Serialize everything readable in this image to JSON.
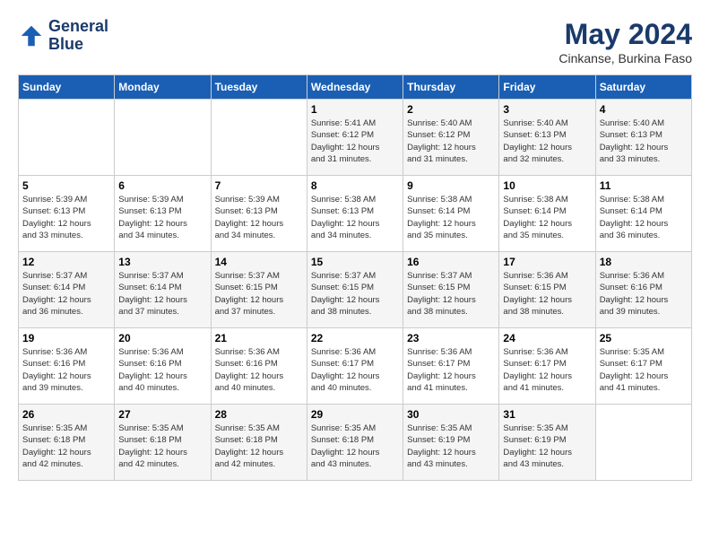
{
  "header": {
    "logo_line1": "General",
    "logo_line2": "Blue",
    "month_title": "May 2024",
    "location": "Cinkanse, Burkina Faso"
  },
  "weekdays": [
    "Sunday",
    "Monday",
    "Tuesday",
    "Wednesday",
    "Thursday",
    "Friday",
    "Saturday"
  ],
  "weeks": [
    [
      {
        "day": "",
        "info": ""
      },
      {
        "day": "",
        "info": ""
      },
      {
        "day": "",
        "info": ""
      },
      {
        "day": "1",
        "info": "Sunrise: 5:41 AM\nSunset: 6:12 PM\nDaylight: 12 hours\nand 31 minutes."
      },
      {
        "day": "2",
        "info": "Sunrise: 5:40 AM\nSunset: 6:12 PM\nDaylight: 12 hours\nand 31 minutes."
      },
      {
        "day": "3",
        "info": "Sunrise: 5:40 AM\nSunset: 6:13 PM\nDaylight: 12 hours\nand 32 minutes."
      },
      {
        "day": "4",
        "info": "Sunrise: 5:40 AM\nSunset: 6:13 PM\nDaylight: 12 hours\nand 33 minutes."
      }
    ],
    [
      {
        "day": "5",
        "info": "Sunrise: 5:39 AM\nSunset: 6:13 PM\nDaylight: 12 hours\nand 33 minutes."
      },
      {
        "day": "6",
        "info": "Sunrise: 5:39 AM\nSunset: 6:13 PM\nDaylight: 12 hours\nand 34 minutes."
      },
      {
        "day": "7",
        "info": "Sunrise: 5:39 AM\nSunset: 6:13 PM\nDaylight: 12 hours\nand 34 minutes."
      },
      {
        "day": "8",
        "info": "Sunrise: 5:38 AM\nSunset: 6:13 PM\nDaylight: 12 hours\nand 34 minutes."
      },
      {
        "day": "9",
        "info": "Sunrise: 5:38 AM\nSunset: 6:14 PM\nDaylight: 12 hours\nand 35 minutes."
      },
      {
        "day": "10",
        "info": "Sunrise: 5:38 AM\nSunset: 6:14 PM\nDaylight: 12 hours\nand 35 minutes."
      },
      {
        "day": "11",
        "info": "Sunrise: 5:38 AM\nSunset: 6:14 PM\nDaylight: 12 hours\nand 36 minutes."
      }
    ],
    [
      {
        "day": "12",
        "info": "Sunrise: 5:37 AM\nSunset: 6:14 PM\nDaylight: 12 hours\nand 36 minutes."
      },
      {
        "day": "13",
        "info": "Sunrise: 5:37 AM\nSunset: 6:14 PM\nDaylight: 12 hours\nand 37 minutes."
      },
      {
        "day": "14",
        "info": "Sunrise: 5:37 AM\nSunset: 6:15 PM\nDaylight: 12 hours\nand 37 minutes."
      },
      {
        "day": "15",
        "info": "Sunrise: 5:37 AM\nSunset: 6:15 PM\nDaylight: 12 hours\nand 38 minutes."
      },
      {
        "day": "16",
        "info": "Sunrise: 5:37 AM\nSunset: 6:15 PM\nDaylight: 12 hours\nand 38 minutes."
      },
      {
        "day": "17",
        "info": "Sunrise: 5:36 AM\nSunset: 6:15 PM\nDaylight: 12 hours\nand 38 minutes."
      },
      {
        "day": "18",
        "info": "Sunrise: 5:36 AM\nSunset: 6:16 PM\nDaylight: 12 hours\nand 39 minutes."
      }
    ],
    [
      {
        "day": "19",
        "info": "Sunrise: 5:36 AM\nSunset: 6:16 PM\nDaylight: 12 hours\nand 39 minutes."
      },
      {
        "day": "20",
        "info": "Sunrise: 5:36 AM\nSunset: 6:16 PM\nDaylight: 12 hours\nand 40 minutes."
      },
      {
        "day": "21",
        "info": "Sunrise: 5:36 AM\nSunset: 6:16 PM\nDaylight: 12 hours\nand 40 minutes."
      },
      {
        "day": "22",
        "info": "Sunrise: 5:36 AM\nSunset: 6:17 PM\nDaylight: 12 hours\nand 40 minutes."
      },
      {
        "day": "23",
        "info": "Sunrise: 5:36 AM\nSunset: 6:17 PM\nDaylight: 12 hours\nand 41 minutes."
      },
      {
        "day": "24",
        "info": "Sunrise: 5:36 AM\nSunset: 6:17 PM\nDaylight: 12 hours\nand 41 minutes."
      },
      {
        "day": "25",
        "info": "Sunrise: 5:35 AM\nSunset: 6:17 PM\nDaylight: 12 hours\nand 41 minutes."
      }
    ],
    [
      {
        "day": "26",
        "info": "Sunrise: 5:35 AM\nSunset: 6:18 PM\nDaylight: 12 hours\nand 42 minutes."
      },
      {
        "day": "27",
        "info": "Sunrise: 5:35 AM\nSunset: 6:18 PM\nDaylight: 12 hours\nand 42 minutes."
      },
      {
        "day": "28",
        "info": "Sunrise: 5:35 AM\nSunset: 6:18 PM\nDaylight: 12 hours\nand 42 minutes."
      },
      {
        "day": "29",
        "info": "Sunrise: 5:35 AM\nSunset: 6:18 PM\nDaylight: 12 hours\nand 43 minutes."
      },
      {
        "day": "30",
        "info": "Sunrise: 5:35 AM\nSunset: 6:19 PM\nDaylight: 12 hours\nand 43 minutes."
      },
      {
        "day": "31",
        "info": "Sunrise: 5:35 AM\nSunset: 6:19 PM\nDaylight: 12 hours\nand 43 minutes."
      },
      {
        "day": "",
        "info": ""
      }
    ]
  ]
}
